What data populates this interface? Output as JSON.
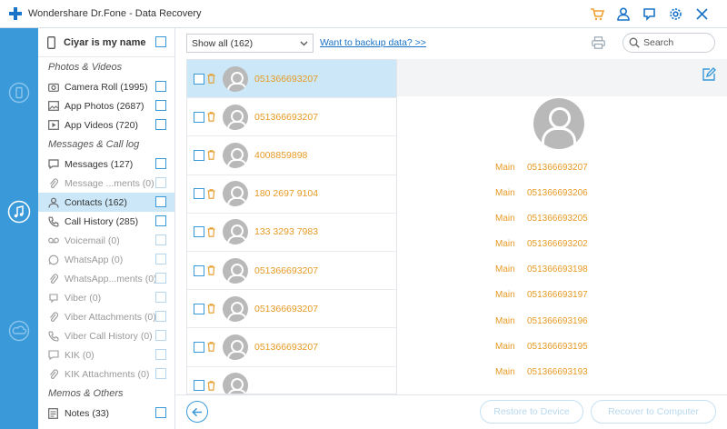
{
  "window": {
    "title": "Wondershare Dr.Fone - Data Recovery",
    "icons": [
      "cart-icon",
      "user-icon",
      "feedback-icon",
      "settings-icon",
      "close-icon"
    ]
  },
  "rail": {
    "items": [
      {
        "name": "ios-device-recovery",
        "active": false
      },
      {
        "name": "itunes-backup-recovery",
        "active": true
      },
      {
        "name": "icloud-backup-recovery",
        "active": false
      }
    ]
  },
  "sidebar": {
    "device_name": "Ciyar is my name",
    "sections": [
      {
        "title": "Photos & Videos"
      },
      {
        "title": "Messages & Call log"
      },
      {
        "title": "Memos & Others"
      }
    ],
    "items": [
      {
        "label": "Camera Roll (1995)",
        "icon": "camera-icon",
        "enabled": true
      },
      {
        "label": "App Photos (2687)",
        "icon": "image-icon",
        "enabled": true
      },
      {
        "label": "App Videos (720)",
        "icon": "video-icon",
        "enabled": true
      },
      {
        "label": "Messages (127)",
        "icon": "message-icon",
        "enabled": true
      },
      {
        "label": "Message ...ments (0)",
        "icon": "attachment-icon",
        "enabled": false
      },
      {
        "label": "Contacts (162)",
        "icon": "contact-icon",
        "enabled": true,
        "active": true
      },
      {
        "label": "Call History (285)",
        "icon": "phone-icon",
        "enabled": true
      },
      {
        "label": "Voicemail (0)",
        "icon": "voicemail-icon",
        "enabled": false
      },
      {
        "label": "WhatsApp (0)",
        "icon": "whatsapp-icon",
        "enabled": false
      },
      {
        "label": "WhatsApp...ments (0)",
        "icon": "attachment-icon",
        "enabled": false
      },
      {
        "label": "Viber (0)",
        "icon": "viber-icon",
        "enabled": false
      },
      {
        "label": "Viber Attachments (0)",
        "icon": "attachment-icon",
        "enabled": false
      },
      {
        "label": "Viber Call History (0)",
        "icon": "phone-icon",
        "enabled": false
      },
      {
        "label": "KIK (0)",
        "icon": "kik-icon",
        "enabled": false
      },
      {
        "label": "KIK Attachments (0)",
        "icon": "attachment-icon",
        "enabled": false
      },
      {
        "label": "Notes (33)",
        "icon": "notes-icon",
        "enabled": true
      }
    ]
  },
  "toolbar": {
    "filter_selected": "Show all (162)",
    "backup_link": "Want to backup data? >>",
    "search_placeholder": "Search"
  },
  "contacts": [
    {
      "number": "051366693207",
      "selected": true
    },
    {
      "number": "051366693207",
      "selected": false
    },
    {
      "number": "4008859898",
      "selected": false
    },
    {
      "number": "180 2697 9104",
      "selected": false
    },
    {
      "number": "133 3293 7983",
      "selected": false
    },
    {
      "number": "051366693207",
      "selected": false
    },
    {
      "number": "051366693207",
      "selected": false
    },
    {
      "number": "051366693207",
      "selected": false
    },
    {
      "number": "",
      "selected": false
    }
  ],
  "detail": {
    "phones": [
      {
        "type": "Main",
        "number": "051366693207"
      },
      {
        "type": "Main",
        "number": "051366693206"
      },
      {
        "type": "Main",
        "number": "051366693205"
      },
      {
        "type": "Main",
        "number": "051366693202"
      },
      {
        "type": "Main",
        "number": "051366693198"
      },
      {
        "type": "Main",
        "number": "051366693197"
      },
      {
        "type": "Main",
        "number": "051366693196"
      },
      {
        "type": "Main",
        "number": "051366693195"
      },
      {
        "type": "Main",
        "number": "051366693193"
      }
    ]
  },
  "bottom": {
    "restore_device": "Restore to Device",
    "recover_computer": "Recover to Computer"
  },
  "colors": {
    "accent": "#3a9ad9",
    "selected_bg": "#cce8f8",
    "number_text": "#e69a24",
    "cart_icon": "#f0a030"
  }
}
